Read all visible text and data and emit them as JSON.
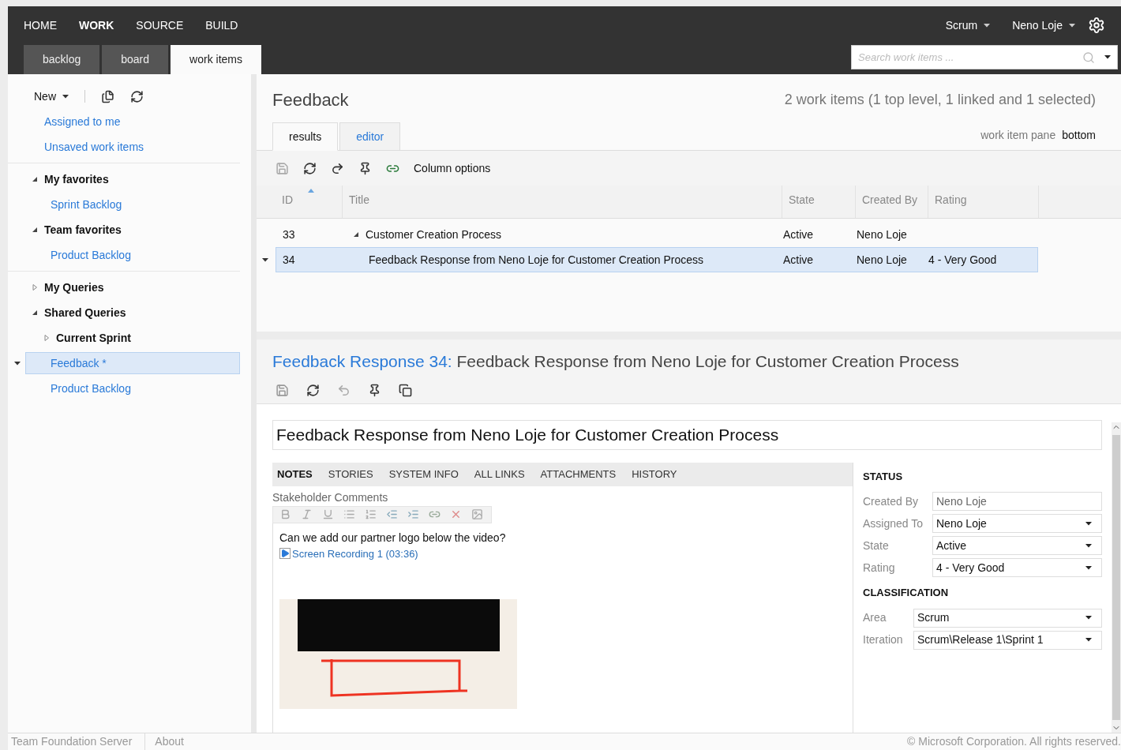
{
  "top_nav": {
    "items": [
      {
        "label": "HOME",
        "selected": false
      },
      {
        "label": "WORK",
        "selected": true
      },
      {
        "label": "SOURCE",
        "selected": false
      },
      {
        "label": "BUILD",
        "selected": false
      }
    ],
    "project": "Scrum",
    "user": "Neno Loje"
  },
  "sub_tabs": [
    {
      "label": "backlog",
      "selected": false
    },
    {
      "label": "board",
      "selected": false
    },
    {
      "label": "work items",
      "selected": true
    }
  ],
  "search": {
    "placeholder": "Search work items ..."
  },
  "sidebar": {
    "new_button": "New",
    "links": [
      "Assigned to me",
      "Unsaved work items"
    ],
    "sections": [
      [
        {
          "label": "My favorites",
          "kind": "folder",
          "expanded": true,
          "children": [
            {
              "label": "Sprint Backlog",
              "kind": "query",
              "selected": false
            }
          ]
        },
        {
          "label": "Team favorites",
          "kind": "folder",
          "expanded": true,
          "children": [
            {
              "label": "Product Backlog",
              "kind": "query",
              "selected": false
            }
          ]
        }
      ],
      [
        {
          "label": "My Queries",
          "kind": "folder",
          "expanded": false
        },
        {
          "label": "Shared Queries",
          "kind": "folder",
          "expanded": true,
          "children": [
            {
              "label": "Current Sprint",
              "kind": "folder",
              "expanded": false
            },
            {
              "label": "Feedback *",
              "kind": "query",
              "selected": true
            },
            {
              "label": "Product Backlog",
              "kind": "query",
              "selected": false
            }
          ]
        }
      ]
    ]
  },
  "query": {
    "title": "Feedback",
    "summary": "2 work items (1 top level, 1 linked and 1 selected)",
    "tabs": [
      {
        "label": "results",
        "selected": true
      },
      {
        "label": "editor",
        "selected": false
      }
    ],
    "pane_label": "work item pane",
    "pane_value": "bottom",
    "column_options": "Column options",
    "columns": [
      "ID",
      "Title",
      "State",
      "Created By",
      "Rating"
    ],
    "rows": [
      {
        "id": "33",
        "title": "Customer Creation Process",
        "state": "Active",
        "created_by": "Neno Loje",
        "rating": "",
        "selected": false,
        "expanded": true,
        "children": [
          {
            "id": "34",
            "title": "Feedback Response from Neno Loje for Customer Creation Process",
            "state": "Active",
            "created_by": "Neno Loje",
            "rating": "4 - Very Good",
            "selected": true
          }
        ]
      }
    ]
  },
  "work_item": {
    "type_label": "Feedback Response 34:",
    "title": "Feedback Response from Neno Loje for Customer Creation Process",
    "title_value": "Feedback Response from Neno Loje for Customer Creation Process",
    "tabs": [
      {
        "label": "NOTES",
        "selected": true
      },
      {
        "label": "STORIES",
        "selected": false
      },
      {
        "label": "SYSTEM INFO",
        "selected": false
      },
      {
        "label": "ALL LINKS",
        "selected": false
      },
      {
        "label": "ATTACHMENTS",
        "selected": false
      },
      {
        "label": "HISTORY",
        "selected": false
      }
    ],
    "notes_label": "Stakeholder Comments",
    "comment": "Can we add our partner logo below the video?",
    "recording_link": "Screen Recording 1 (03:36)",
    "groups": [
      {
        "heading": "STATUS",
        "fields": [
          {
            "label": "Created By",
            "value": "Neno Loje",
            "kind": "readonly"
          },
          {
            "label": "Assigned To",
            "value": "Neno Loje",
            "kind": "dropdown"
          },
          {
            "label": "State",
            "value": "Active",
            "kind": "dropdown"
          },
          {
            "label": "Rating",
            "value": "4 - Very Good",
            "kind": "dropdown"
          }
        ]
      },
      {
        "heading": "CLASSIFICATION",
        "fields": [
          {
            "label": "Area",
            "value": "Scrum",
            "kind": "dropdown"
          },
          {
            "label": "Iteration",
            "value": "Scrum\\Release 1\\Sprint 1",
            "kind": "dropdown"
          }
        ]
      }
    ]
  },
  "footer": {
    "left": [
      "Team Foundation Server",
      "About"
    ],
    "right": "© Microsoft Corporation. All rights reserved."
  }
}
